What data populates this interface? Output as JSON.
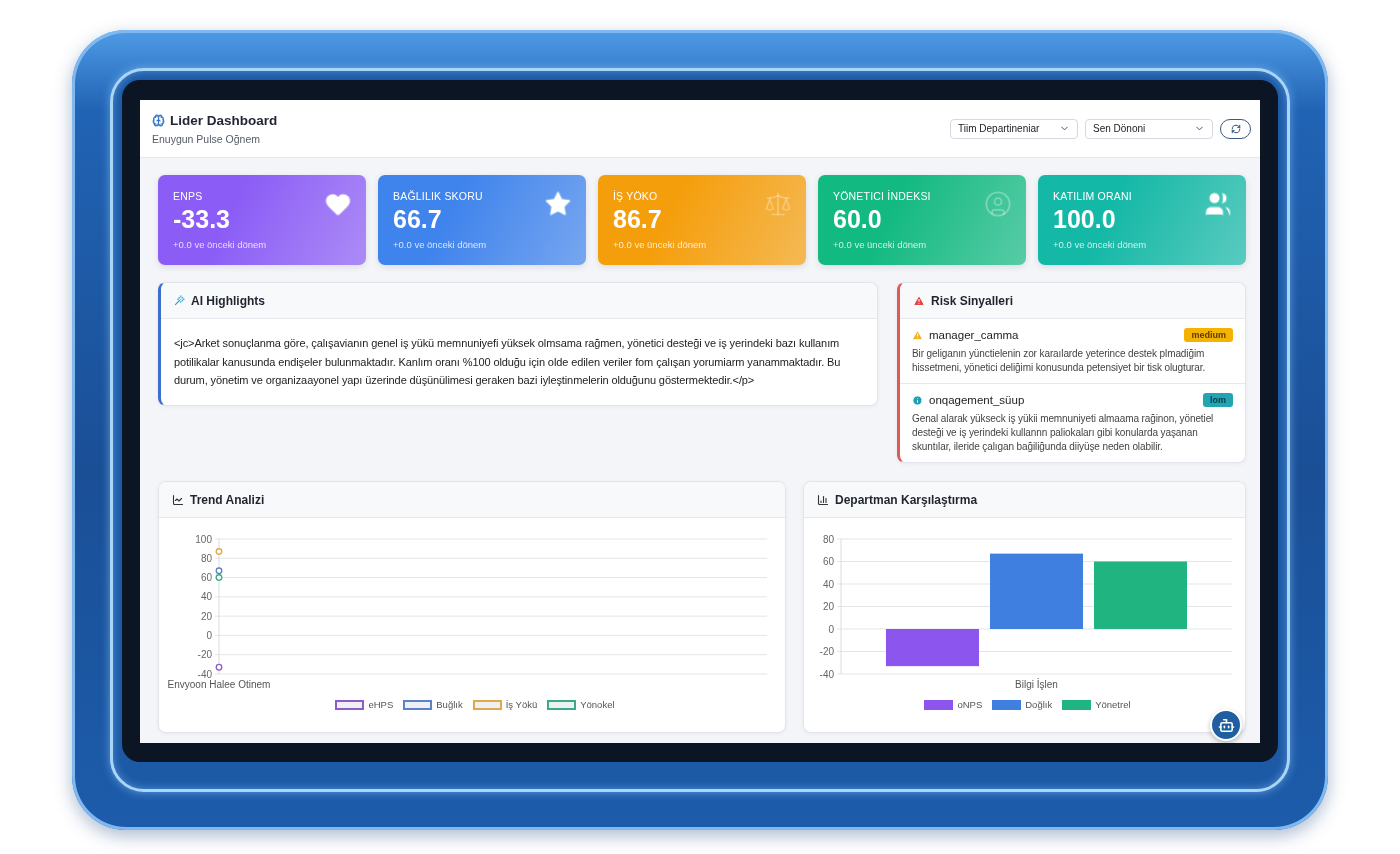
{
  "header": {
    "title": "Lider Dashboard",
    "subtitle": "Enuygun Pulse Oğnem",
    "filters": [
      {
        "value": "Tiim Departineniar"
      },
      {
        "value": "Sen Dönoni"
      }
    ]
  },
  "kpi_cards": [
    {
      "label": "ENPS",
      "value": "-33.3",
      "change": "+0.0 ve önceki dönem",
      "color": "#8b5cf6"
    },
    {
      "label": "BAĞLILIK SKORU",
      "value": "66.7",
      "change": "+0.0 ve önceki dönem",
      "color": "#3f83ec"
    },
    {
      "label": "İŞ YÖKO",
      "value": "86.7",
      "change": "+0.0 ve ünceki dönem",
      "color": "#f59e0b"
    },
    {
      "label": "YÖNETICI İNDEKSI",
      "value": "60.0",
      "change": "+0.0 ve ünceki dönem",
      "color": "#12b981"
    },
    {
      "label": "KATILIM ORANI",
      "value": "100.0",
      "change": "+0.0 ve önceki dönem",
      "color": "#14b8a6"
    }
  ],
  "ai_highlights": {
    "title": "AI Highlights",
    "text": "<jc>Arket sonuçlanma göre, çalışavianın genel iş yükü memnuniyefi yüksek olmsama rağmen, yönetici desteği ve iş yerindeki bazı kullanım potilikalar kanusunda endişeler bulunmaktadır. Kanlım oranı %100 olduğu için olde edilen veriler fom çalışan yorumiarm yanammaktadır. Bu durum, yönetim ve organizaayonel yapı üzerinde düşünülimesi geraken bazi iyleştinmelerin olduğunu göstermektedir.</p>"
  },
  "risk_signals": {
    "title": "Risk Sinyalleri",
    "items": [
      {
        "kind": "warning",
        "name": "manager_camma",
        "badge": "medium",
        "text": "Bir geliganın yünctielenin zor karaılarde yeterince destek plmadiğim hissetmeni, yönetici deliğimi konusunda petensiyet bir tisk olugturar."
      },
      {
        "kind": "info",
        "name": "onqagement_süup",
        "badge": "lom",
        "text": "Genal alarak yükseck iş yükii memnuniyeti almaama rağinon, yönetiel desteği ve iş yerindeki kullannn paliokaları gibi konularda yaşanan skuntılar, ileride çalıgan bağiliğunda diiyüşe neden olabilir."
      }
    ]
  },
  "trend": {
    "title": "Trend Analizi",
    "chart_data": {
      "type": "line",
      "categories": [
        "Envyoon Halee Otinem"
      ],
      "ylim": [
        -40,
        100
      ],
      "yticks": [
        100,
        80,
        60,
        40,
        20,
        0,
        -20,
        -40
      ],
      "grid": true,
      "legend": "bottom",
      "series": [
        {
          "name": "eHPS",
          "color": "#8e5cc9",
          "marker": "circle",
          "values": [
            -33
          ]
        },
        {
          "name": "Buğlık",
          "color": "#5a82c6",
          "marker": "circle",
          "values": [
            67
          ]
        },
        {
          "name": "İş Yökü",
          "color": "#e0a84a",
          "marker": "circle",
          "values": [
            87
          ]
        },
        {
          "name": "Yönokel",
          "color": "#3aab83",
          "marker": "circle",
          "values": [
            60
          ]
        }
      ]
    }
  },
  "department_comparison": {
    "title": "Departman Karşılaştırma",
    "chart_data": {
      "type": "bar",
      "categories": [
        "Bilgi İşlen"
      ],
      "ylim": [
        -40,
        80
      ],
      "yticks": [
        80,
        60,
        40,
        20,
        0,
        -20,
        -40
      ],
      "grid": true,
      "legend": "bottom",
      "series": [
        {
          "name": "oNPS",
          "color": "#8b55ee",
          "values": [
            -33
          ]
        },
        {
          "name": "Doğlık",
          "color": "#3f7fe0",
          "values": [
            67
          ]
        },
        {
          "name": "Yönetrel",
          "color": "#1fb480",
          "values": [
            60
          ]
        }
      ]
    }
  }
}
